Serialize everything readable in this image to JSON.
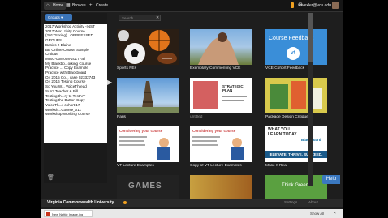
{
  "topbar": {
    "home": "Home",
    "browse": "Browse",
    "create": "Create",
    "user": "wwexler@vcu.edu",
    "badge": "1"
  },
  "sidebar": {
    "groups_label": "Groups",
    "items": [
      "2017 Workshop Activity -INST",
      "2017 Wor...tivity Course",
      "(2017Spring)...OPPRESSED",
      "GROUPS",
      "Basics 2 Elaine",
      "BB Online Course Sample",
      "Critique",
      "MISC-008-008-2017Fall",
      "My Blackbo...orking Course",
      "Practice ... Copy Example",
      "Practice with Blackboard",
      "Q4 2015 Co... case 02332743",
      "Q4 2016 Testing Course",
      "So You W... VoiceThread",
      "Sun? Teacher & Bill",
      "Testing th...ry to Test VT",
      "Testing the Button Copy",
      "VoiceTh...r cohort 17",
      "Worksh...Course_011",
      "Workshop Working Course"
    ]
  },
  "search": {
    "placeholder": "Search"
  },
  "tiles": [
    {
      "title": "Sports PEs"
    },
    {
      "title": "Exemplary Commenting VCE"
    },
    {
      "title": "VCE Cohort Feedback",
      "thumb_text": "Course Feedback",
      "logo": "vt"
    },
    {
      "title": "Paris"
    },
    {
      "title": "untitled",
      "thumb_text": "STRATEGIC PLAN"
    },
    {
      "title": "Package Design Critique"
    },
    {
      "title": "VT Lecture Examples",
      "thumb_text": "Considering your course"
    },
    {
      "title": "Copy of VT Lecture Examples",
      "thumb_text": "Considering your course"
    },
    {
      "title": "Make It Real",
      "thumb_text": "WHAT YOU LEARN TODAY",
      "thumb_sub": "ELEVATE. THRIVE. SUCCEED.",
      "thumb_brand": "Blackboard"
    },
    {
      "title": "",
      "thumb_text": "GAMES"
    },
    {
      "title": ""
    },
    {
      "title": "",
      "thumb_text": "Think Green"
    }
  ],
  "help": "Help",
  "footer": {
    "university": "Virginia Commonwealth University",
    "settings": "Settings",
    "about": "About"
  },
  "download": {
    "file": "New Nettie Image.jpg",
    "show_all": "Show All",
    "close": "×"
  }
}
